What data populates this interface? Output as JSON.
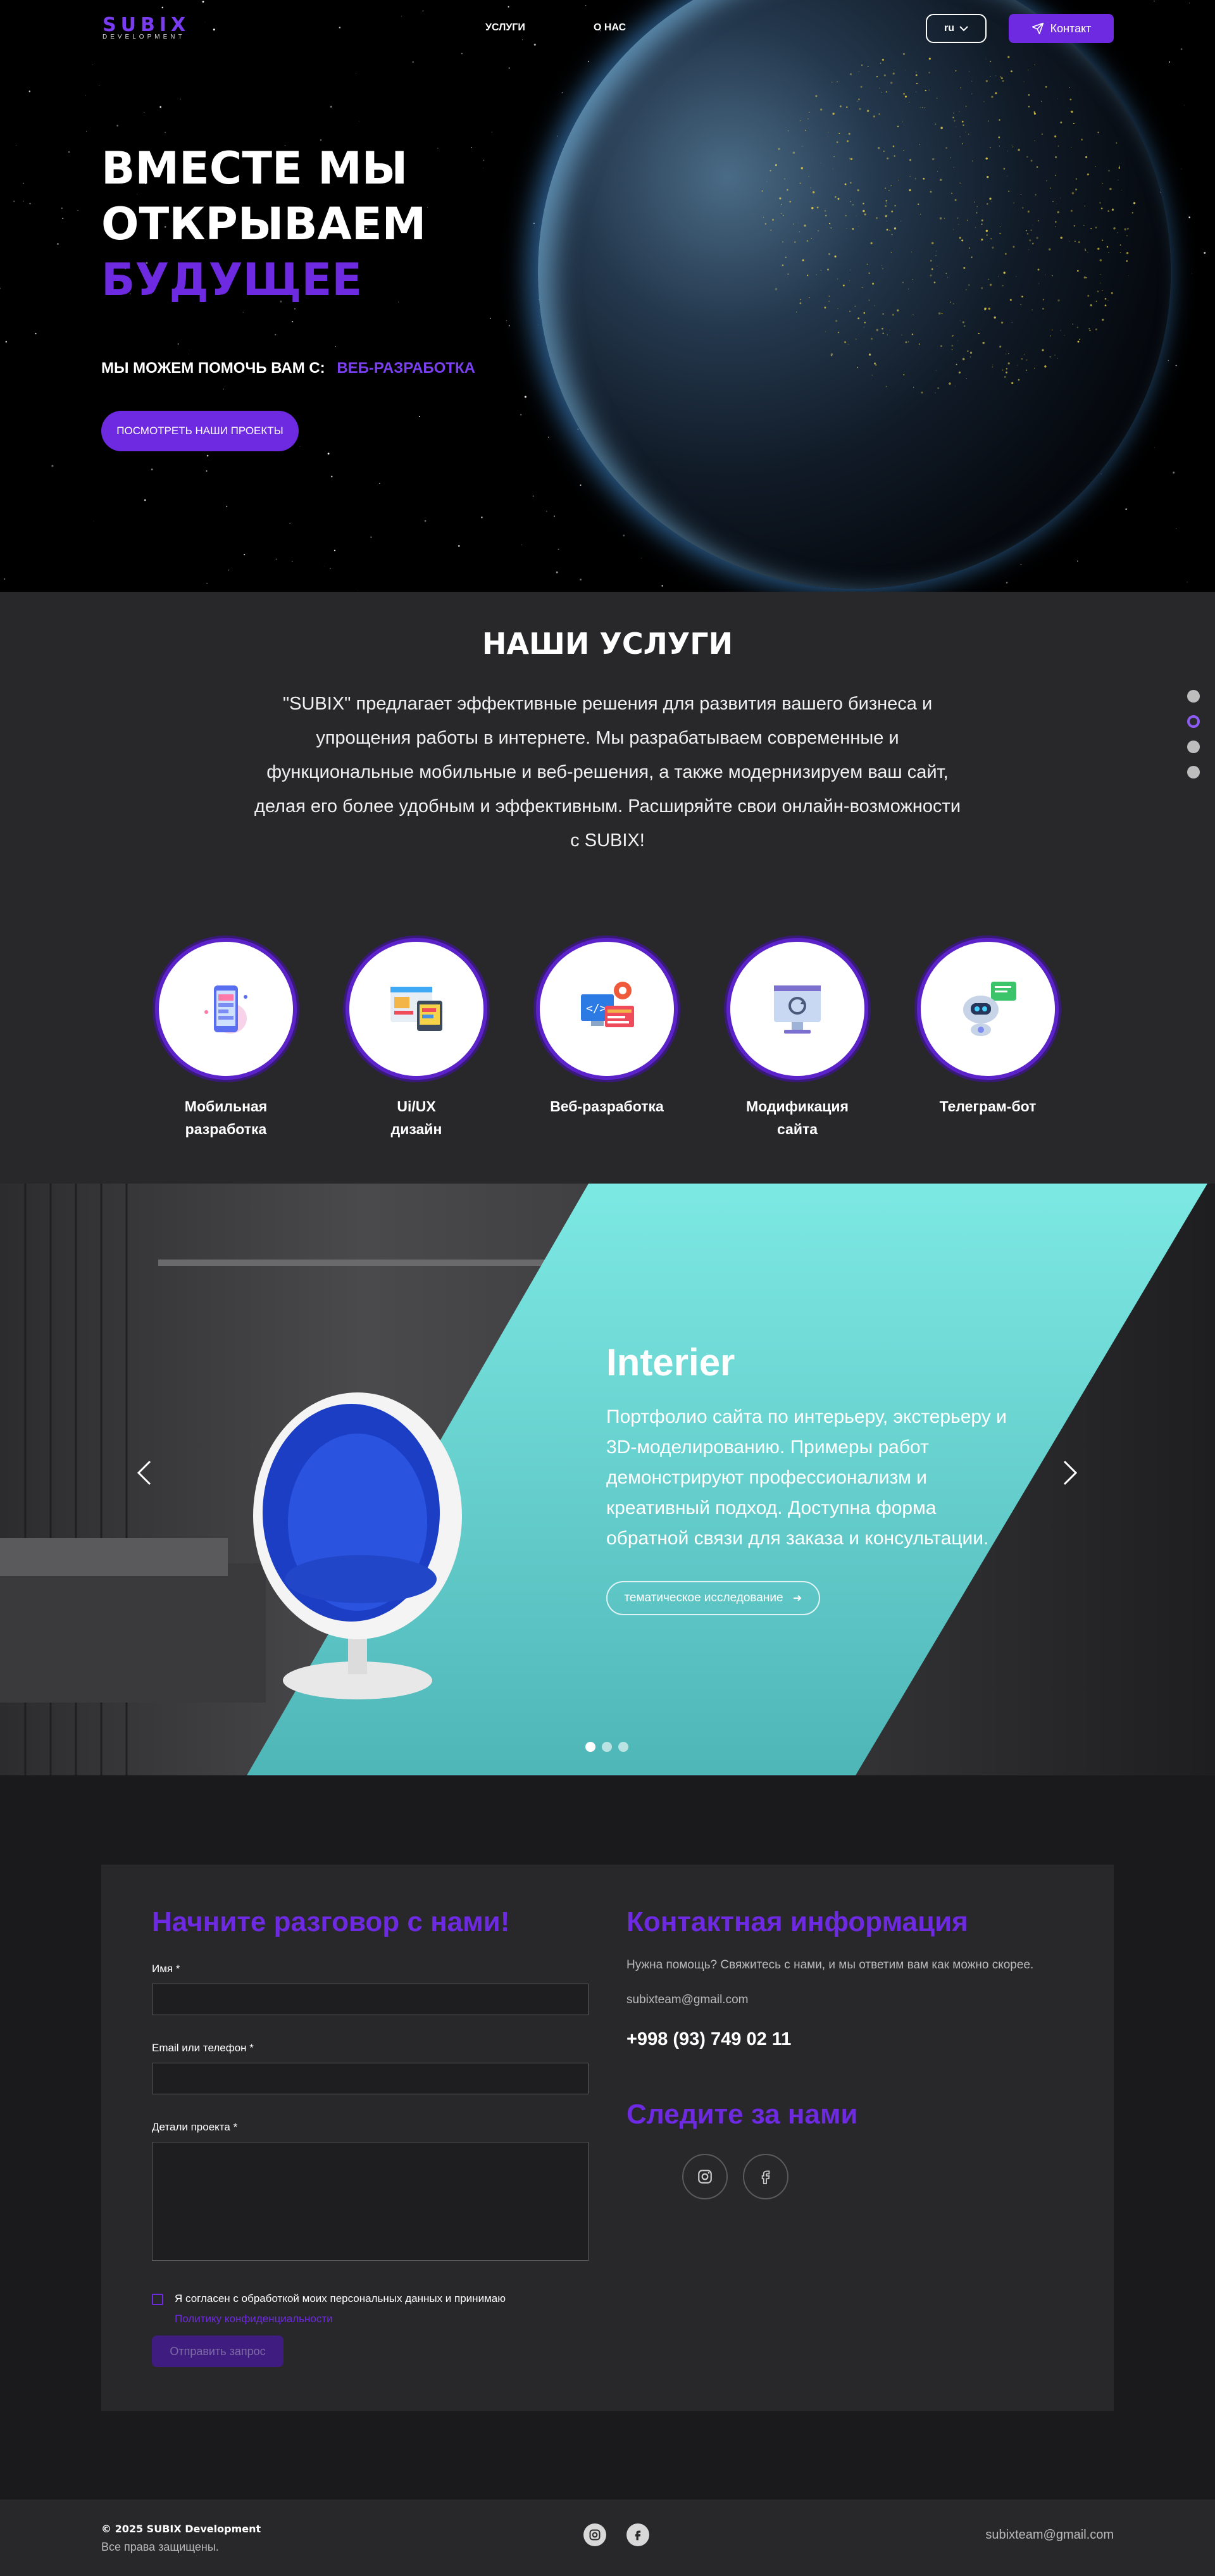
{
  "header": {
    "logo_main": "SUBIX",
    "logo_sub": "DEVELOPMENT",
    "nav": [
      "УСЛУГИ",
      "О НАС"
    ],
    "lang": "ru",
    "contact_label": "Контакт"
  },
  "hero": {
    "title_line1": "ВМЕСТЕ МЫ",
    "title_line2": "ОТКРЫВАЕМ",
    "title_accent": "БУДУЩЕЕ",
    "help_label": "МЫ МОЖЕМ ПОМОЧЬ ВАМ С:",
    "help_value": "ВЕБ-РАЗРАБОТКА",
    "cta": "ПОСМОТРЕТЬ НАШИ ПРОЕКТЫ"
  },
  "services": {
    "title": "НАШИ УСЛУГИ",
    "description": "\"SUBIX\" предлагает эффективные решения для развития вашего бизнеса и упрощения работы в интернете. Мы разрабатываем современные и функциональные мобильные и веб-решения, а также модернизируем ваш сайт, делая его более удобным и эффективным. Расширяйте свои онлайн-возможности с SUBIX!",
    "items": [
      {
        "line1": "Мобильная",
        "line2": "разработка",
        "icon": "mobile-app-icon"
      },
      {
        "line1": "Ui/UX",
        "line2": "дизайн",
        "icon": "ui-design-icon"
      },
      {
        "line1": "Веб-разработка",
        "line2": "",
        "icon": "web-dev-icon"
      },
      {
        "line1": "Модификация",
        "line2": "сайта",
        "icon": "site-update-icon"
      },
      {
        "line1": "Телеграм-бот",
        "line2": "",
        "icon": "robot-icon"
      }
    ]
  },
  "slider": {
    "title": "Interier",
    "text": "Портфолио сайта по интерьеру, экстерьеру и 3D-моделированию. Примеры работ демонстрируют профессионализм и креативный подход. Доступна форма обратной связи для заказа и консультации.",
    "button": "тематическое исследование",
    "slides": 3,
    "active_slide": 1
  },
  "contact": {
    "form_title": "Начните разговор с нами!",
    "name_label": "Имя *",
    "email_label": "Email или телефон *",
    "details_label": "Детали проекта *",
    "consent_text": "Я согласен с обработкой моих персональных данных и принимаю",
    "consent_link": "Политику конфиденциальности",
    "submit": "Отправить запрос",
    "info_title": "Контактная информация",
    "info_text": "Нужна помощь? Свяжитесь с нами, и мы ответим вам как можно скорее.",
    "email": "subixteam@gmail.com",
    "phone": "+998 (93) 749 02 11",
    "follow_title": "Следите за нами"
  },
  "footer": {
    "copyright": "© 2025 SUBIX Development",
    "rights": "Все права защищены.",
    "email": "subixteam@gmail.com"
  },
  "colors": {
    "accent": "#6d2ae0",
    "teal": "#6ed8d4",
    "background": "#1a1a1c"
  }
}
